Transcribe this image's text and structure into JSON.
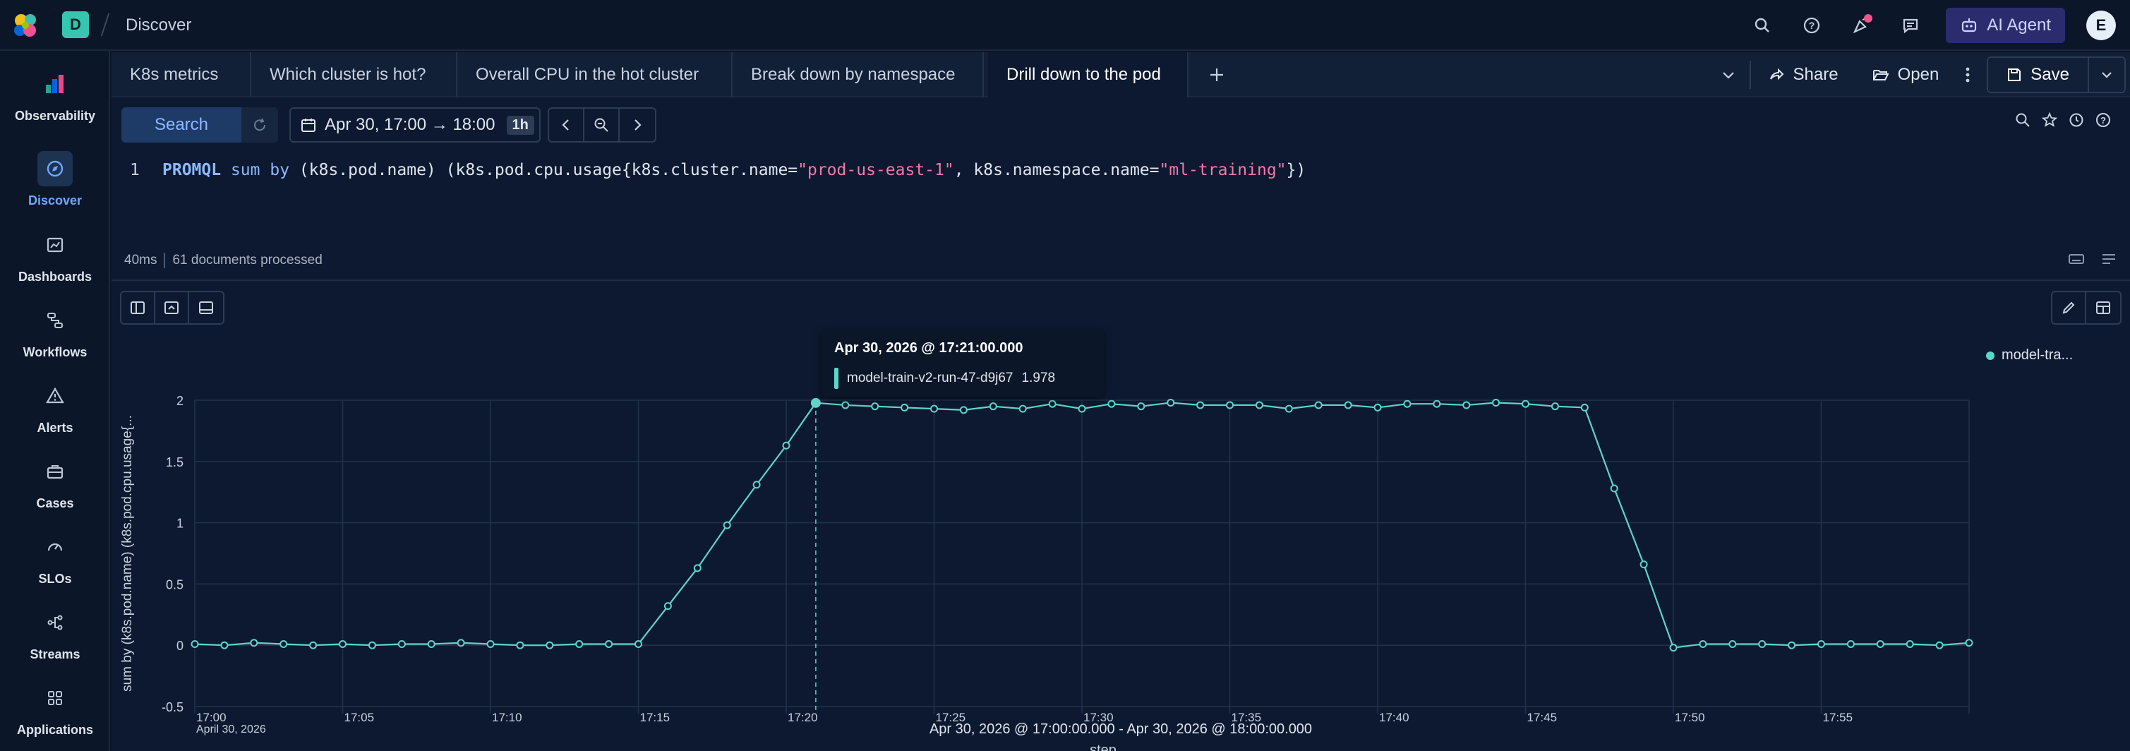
{
  "app": {
    "space_initial": "D",
    "breadcrumb": "Discover",
    "ai_agent_label": "AI Agent",
    "user_initial": "E",
    "colors": {
      "accent": "#6fa8ff",
      "series": "#5cd6c8",
      "notification": "#f0568a",
      "space": "#36c5b0"
    }
  },
  "sidebar": {
    "items": [
      {
        "label": "Observability",
        "icon": "observability-icon",
        "active": false
      },
      {
        "label": "Discover",
        "icon": "discover-icon",
        "active": true
      },
      {
        "label": "Dashboards",
        "icon": "dashboards-icon",
        "active": false
      },
      {
        "label": "Workflows",
        "icon": "workflows-icon",
        "active": false
      },
      {
        "label": "Alerts",
        "icon": "alerts-icon",
        "active": false
      },
      {
        "label": "Cases",
        "icon": "cases-icon",
        "active": false
      },
      {
        "label": "SLOs",
        "icon": "slos-icon",
        "active": false
      },
      {
        "label": "Streams",
        "icon": "streams-icon",
        "active": false
      },
      {
        "label": "Applications",
        "icon": "applications-icon",
        "active": false
      }
    ]
  },
  "tabs": [
    {
      "label": "K8s metrics",
      "active": false
    },
    {
      "label": "Which cluster is hot?",
      "active": false
    },
    {
      "label": "Overall CPU in the hot cluster",
      "active": false
    },
    {
      "label": "Break down by namespace",
      "active": false
    },
    {
      "label": "Drill down to the pod",
      "active": true
    }
  ],
  "tab_actions": {
    "share": "Share",
    "open": "Open",
    "save": "Save"
  },
  "query": {
    "search_label": "Search",
    "time_range": "Apr 30, 17:00 → 18:00",
    "duration": "1h",
    "line_number": "1",
    "keyword": "PROMQL",
    "fn": "sum by",
    "group": "(k8s.pod.name)",
    "metric_open": "(k8s.pod.cpu.usage{k8s.cluster.name=",
    "cluster_value": "\"prod-us-east-1\"",
    "ns_key": ", k8s.namespace.name=",
    "ns_value": "\"ml-training\"",
    "close": "})"
  },
  "status": {
    "took": "40ms",
    "processed": "61 documents processed"
  },
  "tooltip": {
    "title": "Apr 30, 2026 @ 17:21:00.000",
    "series": "model-train-v2-run-47-d9j67",
    "value": "1.978"
  },
  "legend": {
    "label": "model-tra..."
  },
  "range_label": "Apr 30, 2026 @ 17:00:00.000 - Apr 30, 2026 @ 18:00:00.000",
  "chart_data": {
    "type": "line",
    "ylabel": "sum by (k8s.pod.name) (k8s.pod.cpu.usage{...",
    "xlabel": "step",
    "x_date_label": "April 30, 2026",
    "ylim": [
      -0.5,
      2
    ],
    "y_ticks": [
      "-0.5",
      "0",
      "0.5",
      "1",
      "1.5",
      "2"
    ],
    "x_ticks": [
      "17:00",
      "17:05",
      "17:10",
      "17:15",
      "17:20",
      "17:25",
      "17:30",
      "17:35",
      "17:40",
      "17:45",
      "17:50",
      "17:55"
    ],
    "grid": true,
    "legend_position": "top-right",
    "hover_index": 21,
    "series": [
      {
        "name": "model-train-v2-run-47-d9j67",
        "x_minutes": [
          0,
          1,
          2,
          3,
          4,
          5,
          6,
          7,
          8,
          9,
          10,
          11,
          12,
          13,
          14,
          15,
          16,
          17,
          18,
          19,
          20,
          21,
          22,
          23,
          24,
          25,
          26,
          27,
          28,
          29,
          30,
          31,
          32,
          33,
          34,
          35,
          36,
          37,
          38,
          39,
          40,
          41,
          42,
          43,
          44,
          45,
          46,
          47,
          48,
          49,
          50,
          51,
          52,
          53,
          54,
          55,
          56,
          57,
          58,
          59,
          60
        ],
        "values": [
          0.01,
          0.0,
          0.02,
          0.01,
          0.0,
          0.01,
          0.0,
          0.01,
          0.01,
          0.02,
          0.01,
          0.0,
          0.0,
          0.01,
          0.01,
          0.01,
          0.32,
          0.63,
          0.98,
          1.31,
          1.63,
          1.978,
          1.96,
          1.95,
          1.94,
          1.93,
          1.92,
          1.95,
          1.93,
          1.97,
          1.93,
          1.97,
          1.95,
          1.98,
          1.96,
          1.96,
          1.96,
          1.93,
          1.96,
          1.96,
          1.94,
          1.97,
          1.97,
          1.96,
          1.98,
          1.97,
          1.95,
          1.94,
          1.28,
          0.66,
          -0.02,
          0.01,
          0.01,
          0.01,
          0.0,
          0.01,
          0.01,
          0.01,
          0.01,
          0.0,
          0.02
        ]
      }
    ]
  }
}
